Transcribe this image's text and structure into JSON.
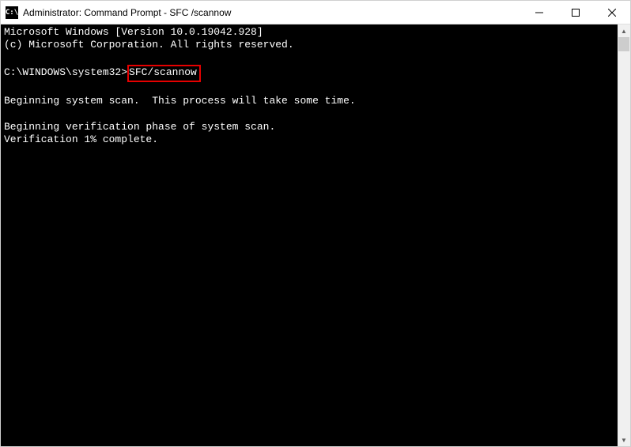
{
  "titlebar": {
    "icon_text": "C:\\",
    "title": "Administrator: Command Prompt - SFC /scannow"
  },
  "terminal": {
    "line1": "Microsoft Windows [Version 10.0.19042.928]",
    "line2": "(c) Microsoft Corporation. All rights reserved.",
    "blank1": "",
    "prompt_path": "C:\\WINDOWS\\system32>",
    "command": "SFC/scannow",
    "blank2": "",
    "line3": "Beginning system scan.  This process will take some time.",
    "blank3": "",
    "line4": "Beginning verification phase of system scan.",
    "line5": "Verification 1% complete."
  }
}
